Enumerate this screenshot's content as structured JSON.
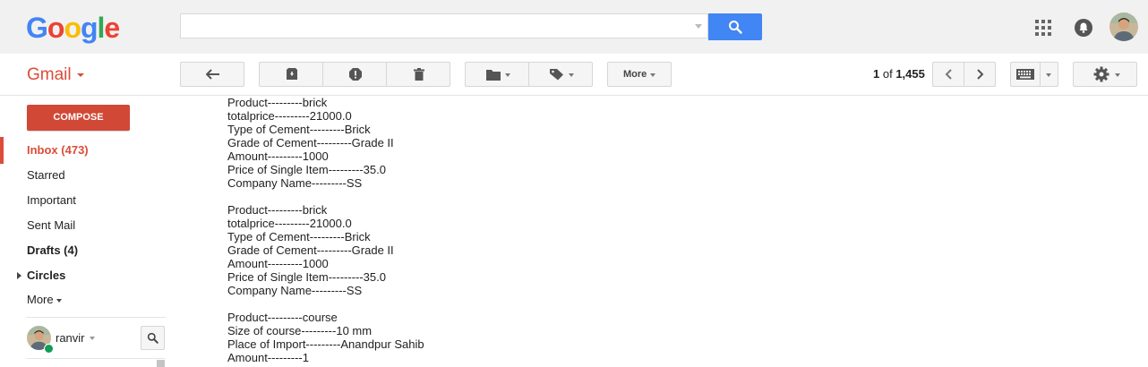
{
  "header": {
    "logo_letters": [
      "G",
      "o",
      "o",
      "g",
      "l",
      "e"
    ],
    "logo_colors": [
      "#4285f4",
      "#ea4335",
      "#fbbc05",
      "#4285f4",
      "#34a853",
      "#ea4335"
    ],
    "search": {
      "value": "",
      "placeholder": ""
    },
    "icons": [
      "search-icon",
      "apps-icon",
      "notifications-icon",
      "account-avatar"
    ]
  },
  "toolbar": {
    "app_label": "Gmail",
    "more_label": "More",
    "count_label_bold": "1",
    "count_label_rest": " of ",
    "count_total": "1,455",
    "icons": [
      "reply-icon",
      "archive-icon",
      "report-spam-icon",
      "delete-icon",
      "move-to-icon",
      "labels-icon",
      "newer-icon",
      "older-icon",
      "keyboard-icon",
      "settings-icon"
    ]
  },
  "sidebar": {
    "compose_label": "COMPOSE",
    "items": [
      {
        "label": "Inbox (473)",
        "active": true,
        "bold": true
      },
      {
        "label": "Starred"
      },
      {
        "label": "Important"
      },
      {
        "label": "Sent Mail"
      },
      {
        "label": "Drafts (4)",
        "bold": true
      },
      {
        "label": "Circles",
        "bold": true,
        "expandable": true
      },
      {
        "label": "More"
      }
    ],
    "user_name": "ranvir"
  },
  "email": {
    "lines": [
      "Product---------brick",
      "totalprice---------21000.0",
      "Type of Cement---------Brick",
      "Grade of Cement---------Grade II",
      "Amount---------1000",
      "Price of Single Item---------35.0",
      "Company Name---------SS",
      "",
      "Product---------brick",
      "totalprice---------21000.0",
      "Type of Cement---------Brick",
      "Grade of Cement---------Grade II",
      "Amount---------1000",
      "Price of Single Item---------35.0",
      "Company Name---------SS",
      "",
      "Product---------course",
      "Size of course---------10 mm",
      "Place of Import---------Anandpur Sahib",
      "Amount---------1"
    ]
  },
  "colors": {
    "accent_red": "#dd4b39",
    "compose_red": "#d14836",
    "search_blue": "#4285f4",
    "online_green": "#0f9d58"
  }
}
